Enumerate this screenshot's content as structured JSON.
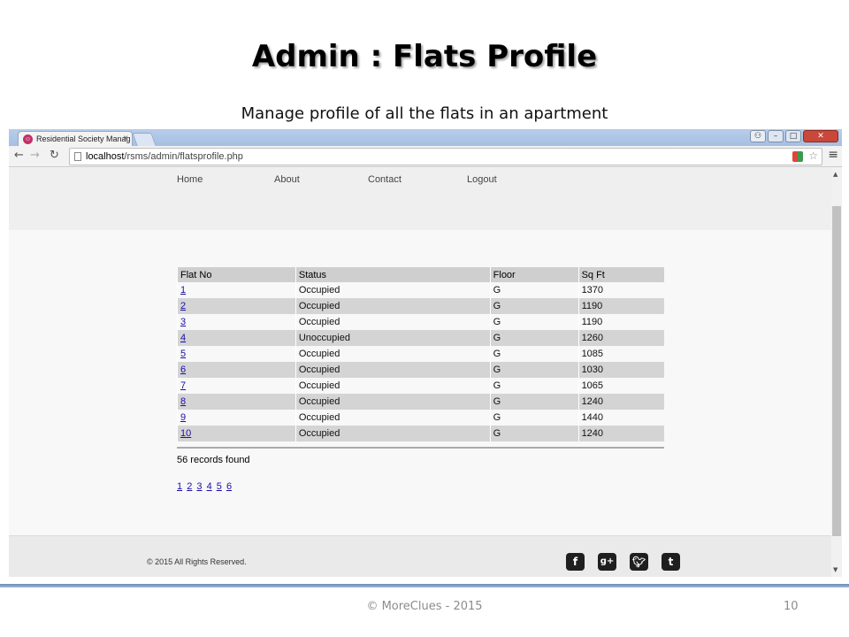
{
  "slide": {
    "title": "Admin : Flats Profile",
    "subtitle": "Manage profile of all the flats in an apartment",
    "footer": "© MoreClues - 2015",
    "page_number": "10"
  },
  "browser": {
    "tab_title": "Residential Society Manag",
    "url_host": "localhost",
    "url_path": "/rsms/admin/flatsprofile.php"
  },
  "site": {
    "nav": [
      "Home",
      "About",
      "Contact",
      "Logout"
    ],
    "table": {
      "headers": [
        "Flat No",
        "Status",
        "Floor",
        "Sq Ft"
      ],
      "rows": [
        [
          "1",
          "Occupied",
          "G",
          "1370"
        ],
        [
          "2",
          "Occupied",
          "G",
          "1190"
        ],
        [
          "3",
          "Occupied",
          "G",
          "1190"
        ],
        [
          "4",
          "Unoccupied",
          "G",
          "1260"
        ],
        [
          "5",
          "Occupied",
          "G",
          "1085"
        ],
        [
          "6",
          "Occupied",
          "G",
          "1030"
        ],
        [
          "7",
          "Occupied",
          "G",
          "1065"
        ],
        [
          "8",
          "Occupied",
          "G",
          "1240"
        ],
        [
          "9",
          "Occupied",
          "G",
          "1440"
        ],
        [
          "10",
          "Occupied",
          "G",
          "1240"
        ]
      ]
    },
    "records_found": "56 records found",
    "pages": [
      "1",
      "2",
      "3",
      "4",
      "5",
      "6"
    ],
    "copyright": "© 2015 All Rights Reserved.",
    "social_icons": [
      "facebook-icon",
      "google-plus-icon",
      "twitter-icon",
      "tumblr-icon"
    ]
  }
}
